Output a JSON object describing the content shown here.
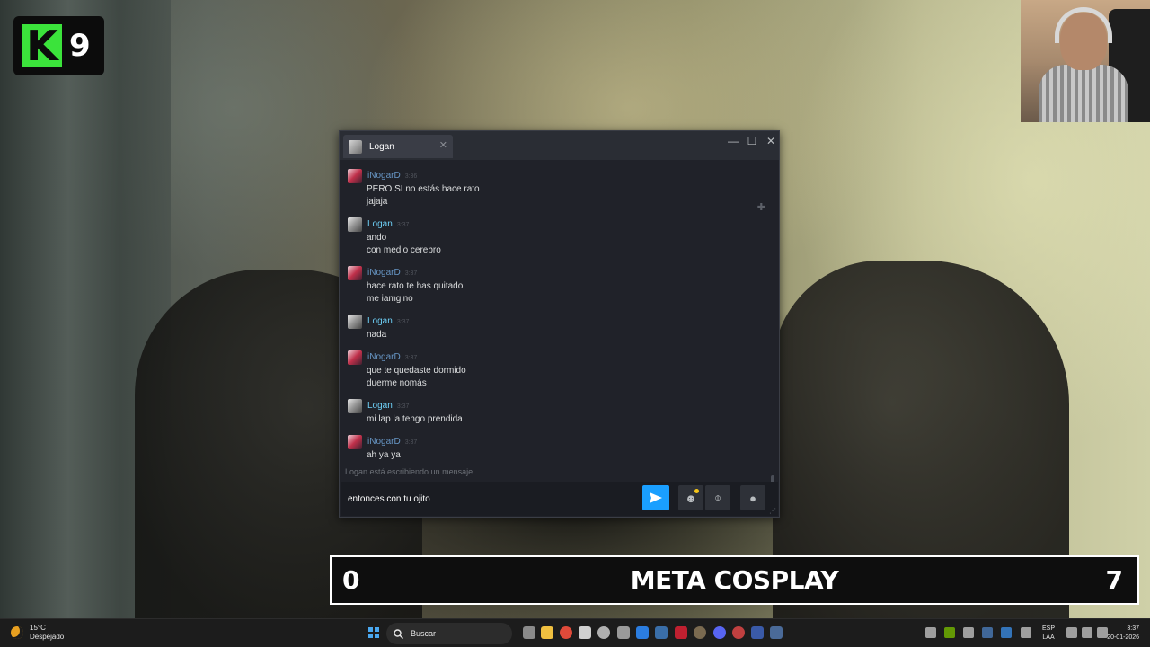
{
  "overlay": {
    "logo_letter": "K",
    "logo_number": "9",
    "banner": {
      "left_score": "0",
      "title": "META COSPLAY",
      "right_score": "7"
    }
  },
  "chat": {
    "tab_title": "Logan",
    "icons": {
      "close": "close-icon",
      "minimize": "minimize-icon",
      "maximize": "maximize-icon",
      "pin": "pin-icon",
      "send": "send-icon",
      "emoji": "emoji-icon",
      "attach": "paperclip-icon",
      "mic": "microphone-icon"
    },
    "messages": [
      {
        "sender": "iNogarD",
        "time": "3:36",
        "lines": [
          "PERO SI no estás hace rato",
          "jajaja"
        ]
      },
      {
        "sender": "Logan",
        "time": "3:37",
        "lines": [
          "ando",
          "con medio cerebro"
        ]
      },
      {
        "sender": "iNogarD",
        "time": "3:37",
        "lines": [
          "hace rato te has quitado",
          "me iamgino"
        ]
      },
      {
        "sender": "Logan",
        "time": "3:37",
        "lines": [
          "nada"
        ]
      },
      {
        "sender": "iNogarD",
        "time": "3:37",
        "lines": [
          "que te quedaste dormido",
          "duerme nomás"
        ]
      },
      {
        "sender": "Logan",
        "time": "3:37",
        "lines": [
          "mi lap la tengo prendida"
        ]
      },
      {
        "sender": "iNogarD",
        "time": "3:37",
        "lines": [
          "ah ya ya"
        ]
      }
    ],
    "typing_indicator": "Logan está escribiendo un mensaje...",
    "input_value": "entonces con tu ojito"
  },
  "taskbar": {
    "weather": {
      "temp": "15°C",
      "condition": "Despejado"
    },
    "search_label": "Buscar",
    "language": {
      "code": "ESP",
      "layout": "LAA"
    },
    "clock": {
      "time": "3:37",
      "date": "20-01-2026"
    }
  },
  "colors": {
    "accent": "#1a9fff",
    "logo_green": "#3be33b",
    "logan_name": "#6dcff6",
    "nogar_name": "#6796c5"
  }
}
